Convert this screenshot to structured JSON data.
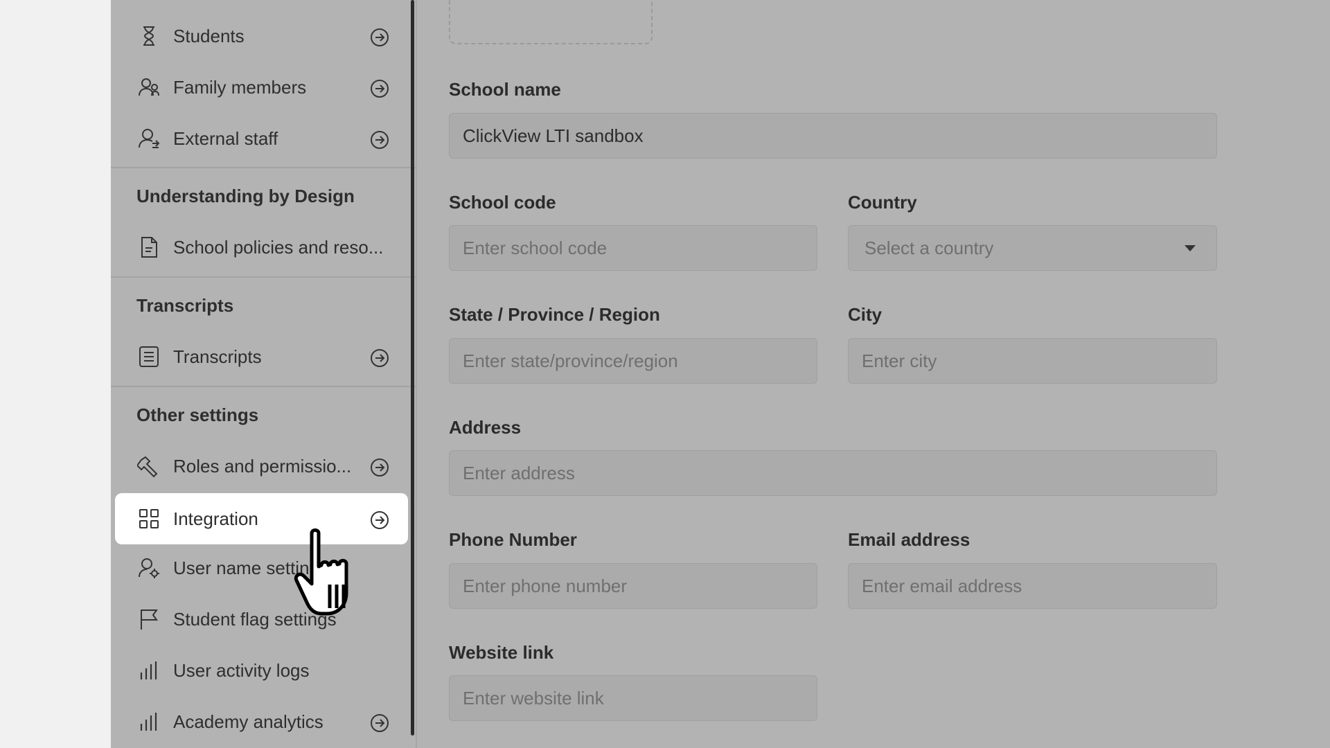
{
  "sidebar": {
    "items_top": [
      {
        "label": "Students",
        "icon": "hourglass-user-icon"
      },
      {
        "label": "Family members",
        "icon": "users-icon"
      },
      {
        "label": "External staff",
        "icon": "user-swap-icon"
      }
    ],
    "sections": [
      {
        "title": "Understanding by Design"
      },
      {
        "title": "Transcripts"
      },
      {
        "title": "Other settings"
      }
    ],
    "ubd_items": [
      {
        "label": "School policies and reso...",
        "icon": "document-icon"
      }
    ],
    "transcript_items": [
      {
        "label": "Transcripts",
        "icon": "list-doc-icon"
      }
    ],
    "other_items": [
      {
        "label": "Roles and permissio...",
        "icon": "wrench-icon"
      },
      {
        "label": "Integration",
        "icon": "grid-icon",
        "active": true
      },
      {
        "label": "User name settings",
        "icon": "user-gear-icon"
      },
      {
        "label": "Student flag settings",
        "icon": "flag-icon"
      },
      {
        "label": "User activity logs",
        "icon": "bar-chart-icon"
      },
      {
        "label": "Academy analytics",
        "icon": "bar-chart-icon"
      }
    ]
  },
  "form": {
    "school_name": {
      "label": "School name",
      "value": "ClickView LTI sandbox"
    },
    "school_code": {
      "label": "School code",
      "placeholder": "Enter school code"
    },
    "country": {
      "label": "Country",
      "placeholder": "Select a country"
    },
    "state": {
      "label": "State / Province / Region",
      "placeholder": "Enter state/province/region"
    },
    "city": {
      "label": "City",
      "placeholder": "Enter city"
    },
    "address": {
      "label": "Address",
      "placeholder": "Enter address"
    },
    "phone": {
      "label": "Phone Number",
      "placeholder": "Enter phone number"
    },
    "email": {
      "label": "Email address",
      "placeholder": "Enter email address"
    },
    "website": {
      "label": "Website link",
      "placeholder": "Enter website link"
    }
  },
  "colors": {
    "overlay": "#b3b3b3",
    "active_item": "#ffffff",
    "page_bg": "#f1f1f1"
  }
}
